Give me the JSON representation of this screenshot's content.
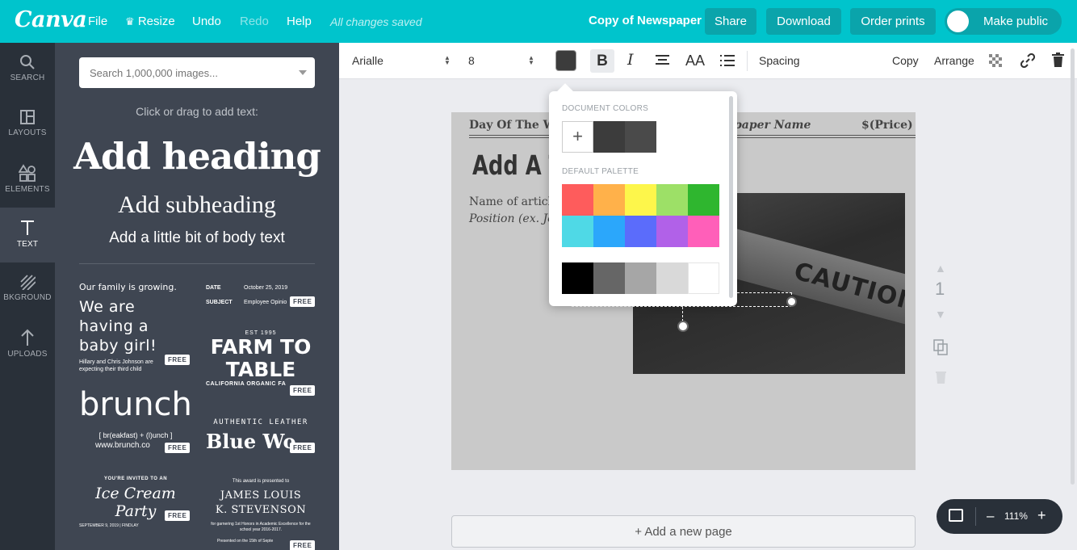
{
  "topbar": {
    "logo": "Canva",
    "menu": {
      "file": "File",
      "resize": "Resize",
      "undo": "Undo",
      "redo": "Redo",
      "help": "Help"
    },
    "saved_status": "All changes saved",
    "doc_title": "Copy of Newspaper",
    "share": "Share",
    "download": "Download",
    "order_prints": "Order prints",
    "make_public": "Make public"
  },
  "rail": {
    "items": [
      {
        "label": "SEARCH",
        "icon": "search-icon"
      },
      {
        "label": "LAYOUTS",
        "icon": "layouts-icon"
      },
      {
        "label": "ELEMENTS",
        "icon": "elements-icon"
      },
      {
        "label": "TEXT",
        "icon": "text-icon"
      },
      {
        "label": "BKGROUND",
        "icon": "background-icon"
      },
      {
        "label": "UPLOADS",
        "icon": "upload-icon"
      }
    ]
  },
  "panel": {
    "search_placeholder": "Search 1,000,000 images...",
    "hint": "Click or drag to add text:",
    "add_heading": "Add heading",
    "add_subheading": "Add subheading",
    "add_body": "Add a little bit of body text",
    "free_badge": "FREE",
    "tiles": {
      "baby_small": "Our family is growing.",
      "baby_big": "We are having a baby girl!",
      "baby_sub": "Hillary and Chris Johnson are expecting their third child",
      "memo_date_label": "DATE",
      "memo_date": "October 25, 2019",
      "memo_subject_label": "SUBJECT",
      "memo_subject": "Employee Opinio",
      "farm_est": "EST 1995",
      "farm_title": "FARM TO TABLE",
      "farm_sub": "CALIFORNIA ORGANIC FA",
      "brunch": "brunch",
      "brunch_def": "[ br(eakfast) + (l)unch ]",
      "brunch_url": "www.brunch.co",
      "leather_small": "AUTHENTIC LEATHER",
      "leather_big": "Blue Wo",
      "party_small": "YOU'RE INVITED TO AN",
      "party_big": "Ice Cream Party",
      "party_date": "SEPTEMBER 9, 2019 | FINDLAY",
      "award_small": "This award is presented to",
      "award_name": "JAMES LOUIS K. STEVENSON",
      "award_sub": "for garnering 1st Honors in Academic Excellence for the school year 2016-2017.",
      "award_sub2": "Presented on the 15th of Septe"
    }
  },
  "toolbar": {
    "font": "Arialle",
    "size": "8",
    "text_color": "#3c3c3c",
    "spacing": "Spacing",
    "copy": "Copy",
    "arrange": "Arrange"
  },
  "page": {
    "day": "Day Of The W",
    "paper_name": "paper Name",
    "price": "$(Price)",
    "title": "Add A Ti",
    "author": "Name of article",
    "position": "Position (ex. Jou",
    "photo_caution": "CAUTION",
    "number": "1",
    "add_page": "+ Add a new page",
    "zoom": "111%"
  },
  "color_popup": {
    "document_colors_label": "DOCUMENT COLORS",
    "default_palette_label": "DEFAULT PALETTE",
    "document_colors": [
      "#3c3c3c",
      "#4a4a4a"
    ],
    "palette_row1": [
      "#fe5c5c",
      "#ffb14a",
      "#fdf64b",
      "#9de067",
      "#2fb62f"
    ],
    "palette_row2": [
      "#4fd9e6",
      "#2ba7fb",
      "#5b6cfb",
      "#b161e8",
      "#ff5fb9"
    ],
    "grays": [
      "#000000",
      "#666666",
      "#a6a6a6",
      "#d9d9d9",
      "#ffffff"
    ]
  }
}
